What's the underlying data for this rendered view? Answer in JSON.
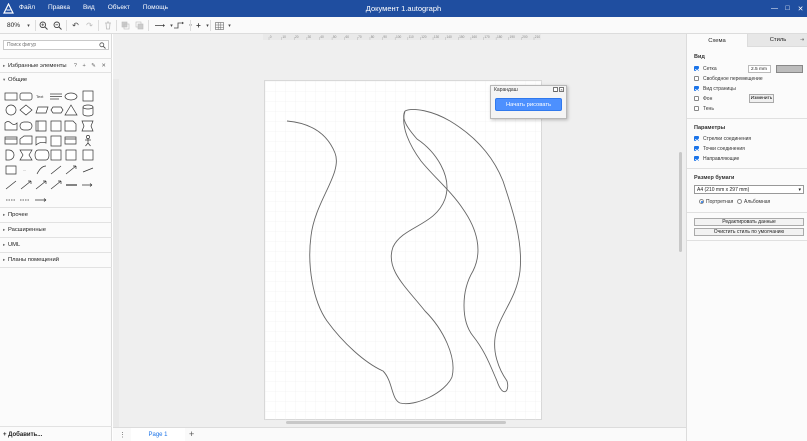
{
  "titlebar": {
    "title": "Документ 1.autograph",
    "menu": [
      "Файл",
      "Правка",
      "Вид",
      "Объект",
      "Помощь"
    ],
    "window_controls": [
      "—",
      "□",
      "✕"
    ]
  },
  "toolbar": {
    "zoom": "80%",
    "icons": [
      "zoom-in-icon",
      "zoom-out-icon",
      "undo-icon",
      "redo-icon",
      "delete-icon",
      "to-front-icon",
      "to-back-icon",
      "waypoint-icon",
      "connection-icon",
      "insert-icon",
      "table-icon"
    ]
  },
  "sidebar": {
    "search_placeholder": "Поиск фигур",
    "favorites": "Избранные элементы",
    "favorites_tools": "? + ✎ ✕",
    "general": "Общие",
    "sections": [
      "Прочее",
      "Расширенные",
      "UML",
      "Планы помещений"
    ],
    "add_more": "+ Добавить..."
  },
  "ruler": {
    "ticks": [
      "0",
      "10",
      "20",
      "30",
      "40",
      "50",
      "60",
      "70",
      "80",
      "90",
      "100",
      "110",
      "120",
      "130",
      "140",
      "150",
      "160",
      "170",
      "180",
      "190",
      "200",
      "210"
    ]
  },
  "pencil_dialog": {
    "title": "Карандаш",
    "button": "Начать рисовать"
  },
  "bottombar": {
    "page_tab": "Page 1",
    "menu_dots": "⋮",
    "add_page": "+"
  },
  "rpanel": {
    "tabs": [
      "Схема",
      "Стиль"
    ],
    "view_title": "Вид",
    "grid_label": "Сетка",
    "grid_size": "2.5 mm",
    "free_move": "Свободное перемещение",
    "page_view": "Вид страницы",
    "background": "Фон",
    "change_button": "Изменить",
    "shadow": "Тень",
    "params_title": "Параметры",
    "conn_arrows": "Стрелки соединения",
    "conn_points": "Точки соединения",
    "guides": "Направляющие",
    "paper_title": "Размер бумаги",
    "paper_size": "A4 (210 mm x 297 mm)",
    "portrait": "Портретная",
    "landscape": "Альбомная",
    "edit_data": "Редактировать данные",
    "clear_style": "Очистить стиль по умолчанию",
    "checks": {
      "grid": true,
      "free_move": false,
      "page_view": true,
      "background": false,
      "shadow": false,
      "conn_arrows": true,
      "conn_points": true,
      "guides": true
    },
    "orientation": "portrait"
  },
  "colors": {
    "titlebar": "#1f4ea0",
    "accent": "#1a73e8",
    "button": "#4d90fe"
  }
}
